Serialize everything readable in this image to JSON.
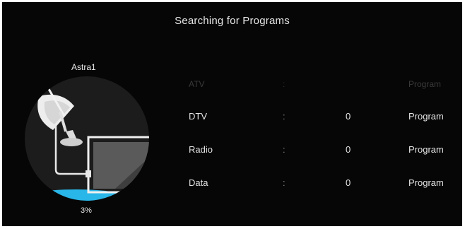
{
  "header": {
    "title": "Searching for Programs"
  },
  "satellite": {
    "name": "Astra1",
    "progress_text": "3%",
    "progress": 0.03
  },
  "rows": [
    {
      "label": "ATV",
      "separator": ":",
      "value": "",
      "unit": "Program"
    },
    {
      "label": "DTV",
      "separator": ":",
      "value": "0",
      "unit": "Program"
    },
    {
      "label": "Radio",
      "separator": ":",
      "value": "0",
      "unit": "Program"
    },
    {
      "label": "Data",
      "separator": ":",
      "value": "0",
      "unit": "Program"
    }
  ],
  "colors": {
    "background": "#060606",
    "circle": "#1c1c1c",
    "progress_fill": "#29b6e8",
    "text": "#e6e6e6",
    "dim_text": "#3a3a3a"
  },
  "icons": [
    "satellite-dish-icon",
    "tv-monitor-icon"
  ]
}
